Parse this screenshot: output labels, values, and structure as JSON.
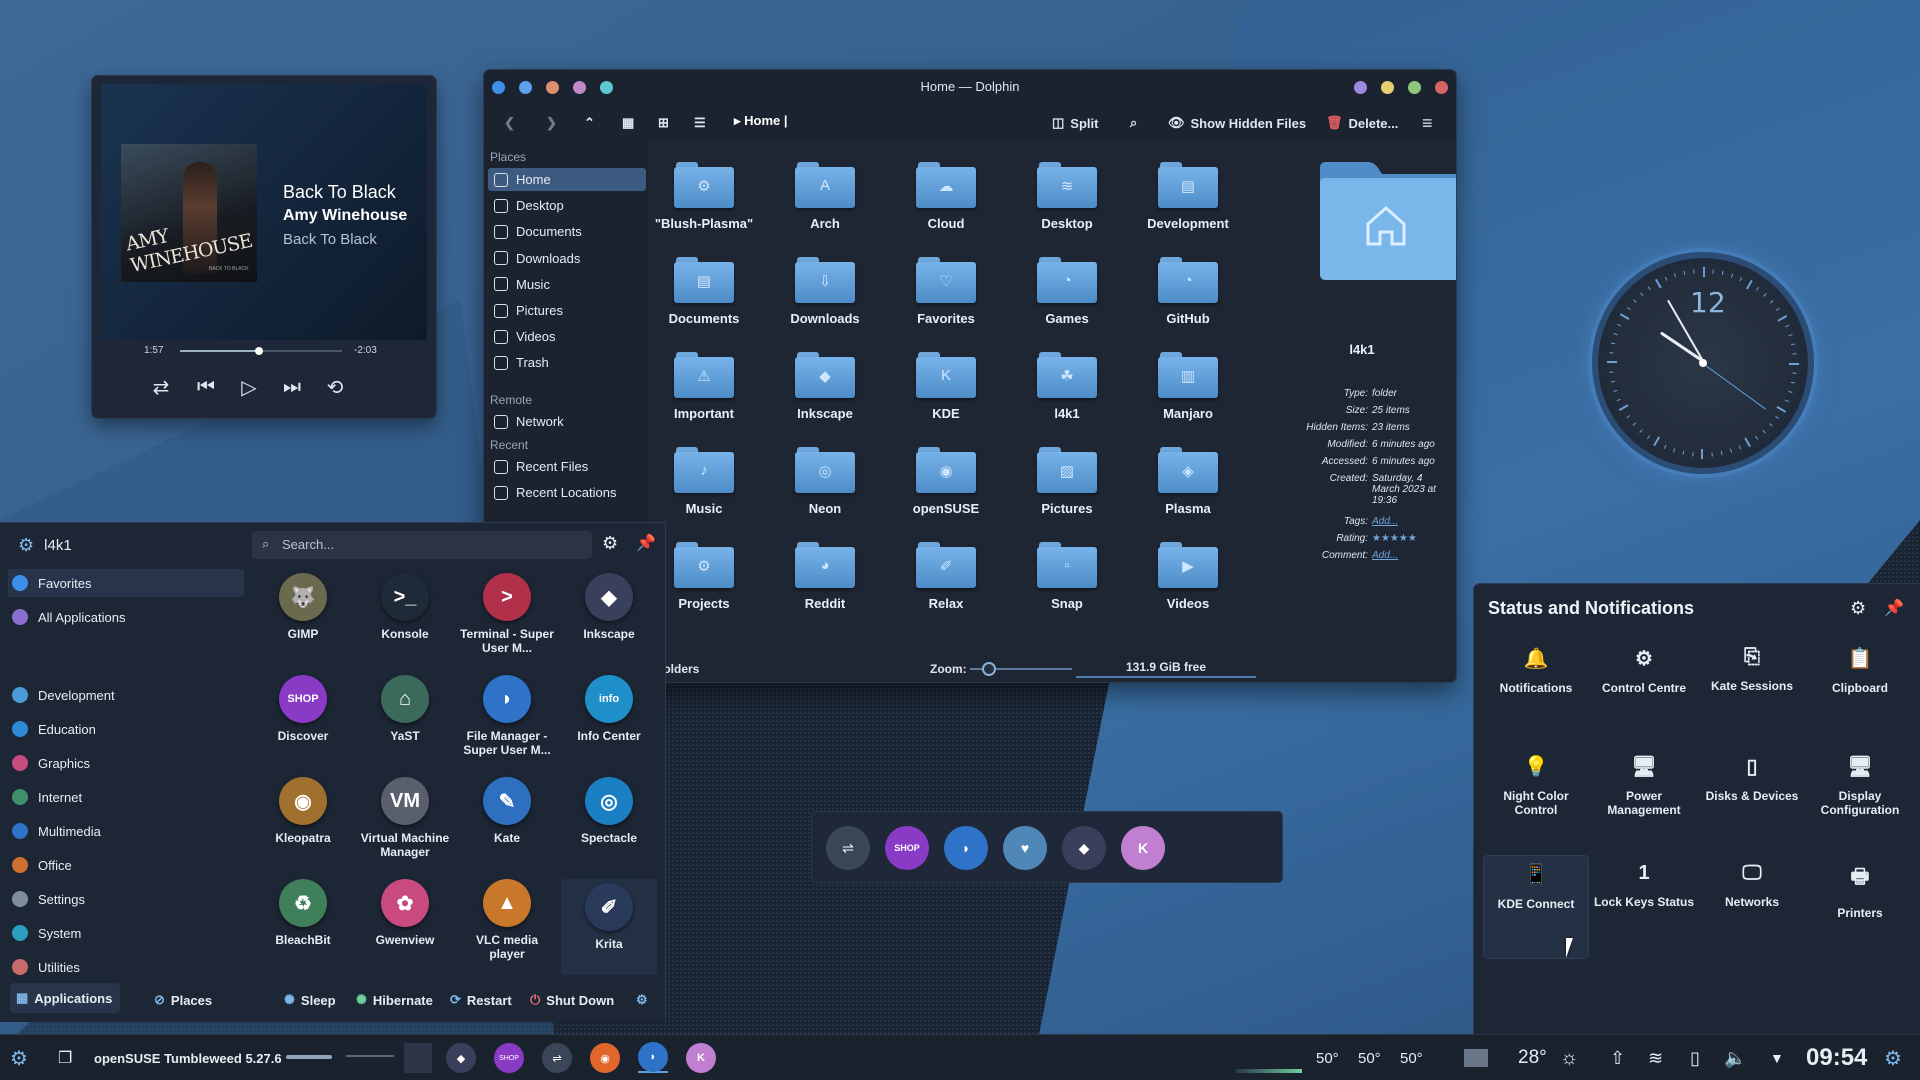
{
  "colors": {
    "accent": "#3d5b80",
    "folder": "#5e9fdc",
    "panel": "#1d2635"
  },
  "player": {
    "title": "Back To Black",
    "artist": "Amy Winehouse",
    "album": "Back To Black",
    "cover_text": "AMY WINEHOUSE",
    "cover_small": "BACK TO BLACK",
    "elapsed": "1:57",
    "remaining": "-2:03",
    "progress": 0.49,
    "controls": [
      "shuffle-icon",
      "previous-icon",
      "play-icon",
      "next-icon",
      "repeat-icon"
    ]
  },
  "dolphin": {
    "title": "Home — Dolphin",
    "breadcrumb": "Home",
    "toolbar": {
      "split": "Split",
      "show_hidden": "Show Hidden Files",
      "delete": "Delete..."
    },
    "places_header": "Places",
    "remote_header": "Remote",
    "recent_header": "Recent",
    "places": [
      "Home",
      "Desktop",
      "Documents",
      "Downloads",
      "Music",
      "Pictures",
      "Videos",
      "Trash"
    ],
    "remote": [
      "Network"
    ],
    "recent": [
      "Recent Files",
      "Recent Locations"
    ],
    "folders": [
      "\"Blush-Plasma\"",
      "Arch",
      "Cloud",
      "Desktop",
      "Development",
      "Documents",
      "Downloads",
      "Favorites",
      "Games",
      "GitHub",
      "Important",
      "Inkscape",
      "KDE",
      "l4k1",
      "Manjaro",
      "Music",
      "Neon",
      "openSUSE",
      "Pictures",
      "Plasma",
      "Projects",
      "Reddit",
      "Relax",
      "Snap",
      "Videos"
    ],
    "status": {
      "left": "Folders",
      "zoom_label": "Zoom:",
      "free": "131.9 GiB free"
    },
    "info": {
      "name": "l4k1",
      "rows": [
        {
          "k": "Type:",
          "v": "folder"
        },
        {
          "k": "Size:",
          "v": "25 items"
        },
        {
          "k": "Hidden Items:",
          "v": "23 items"
        },
        {
          "k": "Modified:",
          "v": "6 minutes ago"
        },
        {
          "k": "Accessed:",
          "v": "6 minutes ago"
        },
        {
          "k": "Created:",
          "v": "Saturday, 4 March 2023 at 19:36"
        },
        {
          "k": "Tags:",
          "v": "Add..."
        },
        {
          "k": "Rating:",
          "v": "★★★★★"
        },
        {
          "k": "Comment:",
          "v": "Add..."
        }
      ]
    }
  },
  "launcher": {
    "user": "l4k1",
    "search_placeholder": "Search...",
    "categories": [
      "Favorites",
      "All Applications",
      "Development",
      "Education",
      "Graphics",
      "Internet",
      "Multimedia",
      "Office",
      "Settings",
      "System",
      "Utilities"
    ],
    "apps": [
      {
        "name": "GIMP",
        "color": "#6b6a4e",
        "glyph": "🐺"
      },
      {
        "name": "Konsole",
        "color": "#1f2a38",
        "glyph": ">_"
      },
      {
        "name": "Terminal - Super User M...",
        "color": "#b1304a",
        "glyph": ">"
      },
      {
        "name": "Inkscape",
        "color": "#3a3f5c",
        "glyph": "◆"
      },
      {
        "name": "Discover",
        "color": "#8a3bc6",
        "glyph": "SHOP"
      },
      {
        "name": "YaST",
        "color": "#3b6a5a",
        "glyph": "⌂"
      },
      {
        "name": "File Manager - Super User M...",
        "color": "#2e73c8",
        "glyph": "◗"
      },
      {
        "name": "Info Center",
        "color": "#1e8fc9",
        "glyph": "info"
      },
      {
        "name": "Kleopatra",
        "color": "#a0702e",
        "glyph": "◉"
      },
      {
        "name": "Virtual Machine Manager",
        "color": "#5a5f6e",
        "glyph": "VM"
      },
      {
        "name": "Kate",
        "color": "#2f6fbf",
        "glyph": "✎"
      },
      {
        "name": "Spectacle",
        "color": "#1b7fc4",
        "glyph": "◎"
      },
      {
        "name": "BleachBit",
        "color": "#3f7f5a",
        "glyph": "♻"
      },
      {
        "name": "Gwenview",
        "color": "#c94a7f",
        "glyph": "✿"
      },
      {
        "name": "VLC media player",
        "color": "#c9772a",
        "glyph": "▲"
      },
      {
        "name": "Krita",
        "color": "#2a3a5a",
        "glyph": "✐"
      }
    ],
    "footer": {
      "applications": "Applications",
      "places": "Places",
      "sleep": "Sleep",
      "hibernate": "Hibernate",
      "restart": "Restart",
      "shutdown": "Shut Down"
    }
  },
  "dock": [
    "settings-sliders",
    "discover-shop",
    "dolphin",
    "heart",
    "inkscape",
    "kdenlive"
  ],
  "clock": {
    "numeral": "12"
  },
  "notifications": {
    "title": "Status and Notifications",
    "items": [
      "Notifications",
      "Control Centre",
      "Kate Sessions",
      "Clipboard",
      "Night Color Control",
      "Power Management",
      "Disks & Devices",
      "Display Configuration",
      "KDE Connect",
      "Lock Keys Status",
      "Networks",
      "Printers"
    ]
  },
  "taskbar": {
    "title": "openSUSE Tumbleweed 5.27.6",
    "temps": [
      "50°",
      "50°",
      "50°"
    ],
    "weather": "28°",
    "time": "09:54"
  }
}
